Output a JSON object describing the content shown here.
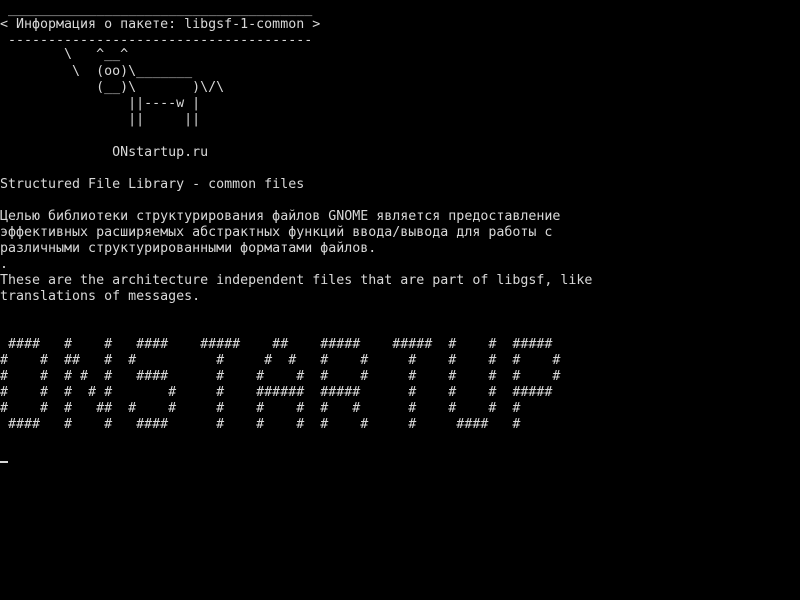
{
  "terminal": {
    "cowsay": {
      "top_border": " ______________________________________",
      "title": "< Информация о пакете: libgsf-1-common >",
      "bottom_border": " --------------------------------------",
      "cow": [
        "        \\   ^__^",
        "         \\  (oo)\\_______",
        "            (__)\\       )\\/\\",
        "                ||----w |",
        "                ||     ||"
      ]
    },
    "site": "              ONstartup.ru",
    "summary": "Structured File Library - common files",
    "description_ru": [
      "Целью библиотеки структурирования файлов GNOME является предоставление",
      "эффективных расширяемых абстрактных функций ввода/вывода для работы с",
      "различными структурированными форматами файлов."
    ],
    "separator": ".",
    "description_en": [
      "These are the architecture independent files that are part of libgsf, like",
      "translations of messages."
    ],
    "banner": [
      " ####   #    #   ####    #####    ##    #####    #####  #    #  #####",
      "#    #  ##   #  #          #     #  #   #    #     #    #    #  #    #",
      "#    #  # #  #   ####      #    #    #  #    #     #    #    #  #    #",
      "#    #  #  # #       #     #    ######  #####      #    #    #  #####",
      "#    #  #   ##  #    #     #    #    #  #   #      #    #    #  #",
      " ####   #    #   ####      #    #    #  #    #     #     ####   #"
    ]
  }
}
